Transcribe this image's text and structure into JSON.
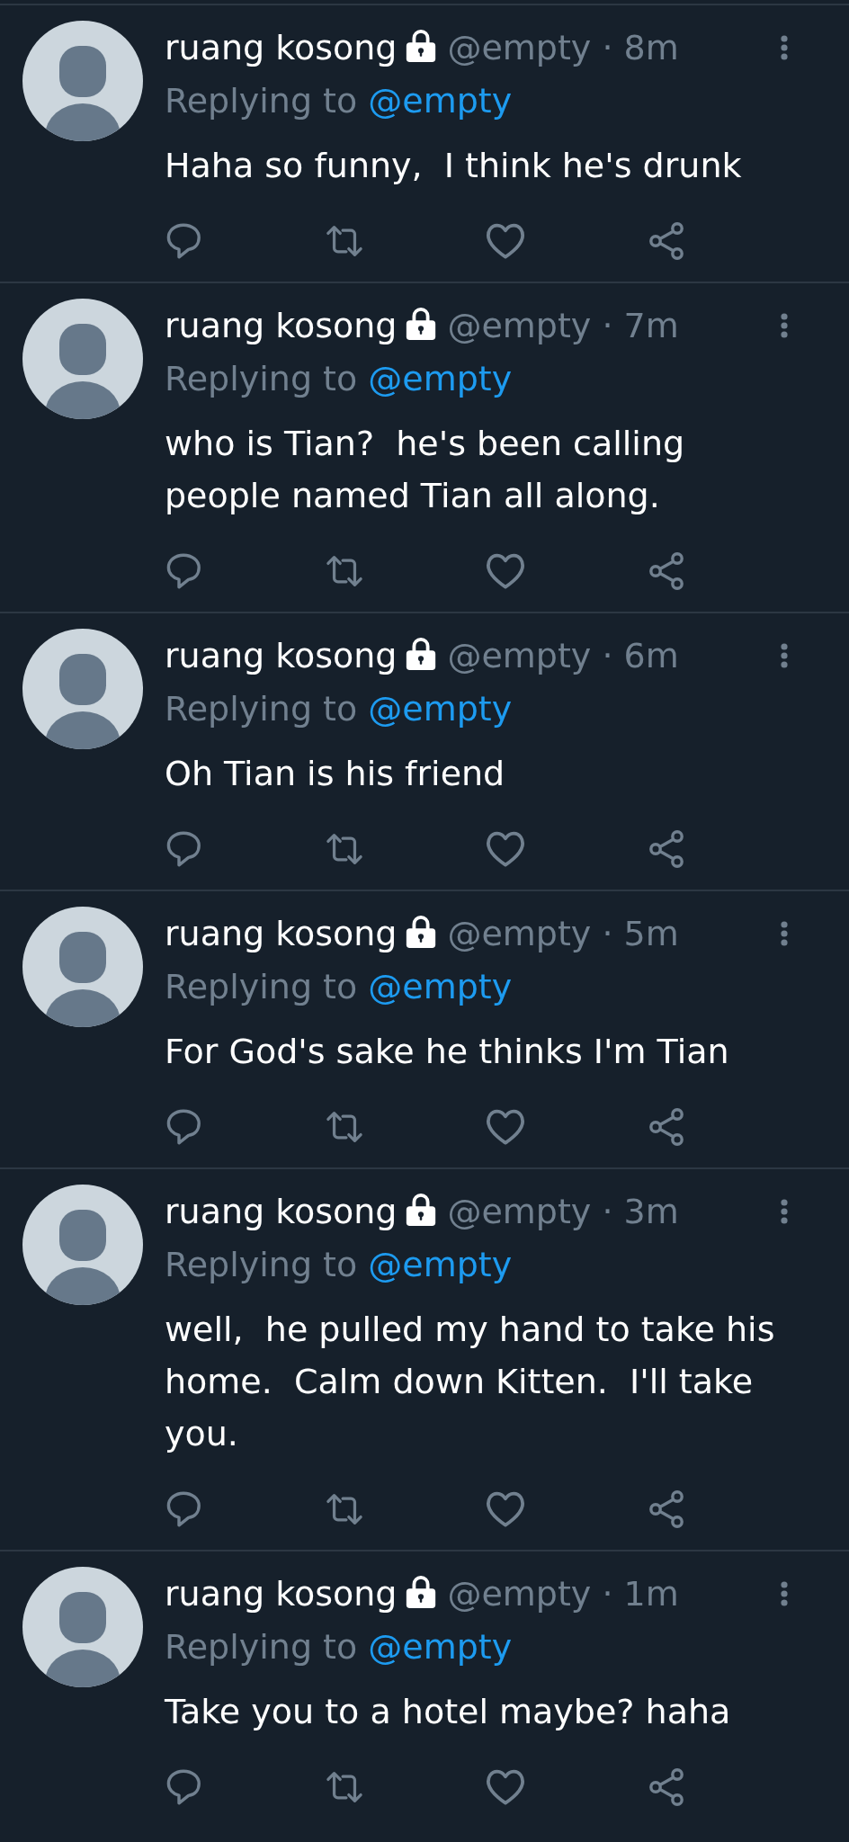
{
  "tweets": [
    {
      "name": "ruang kosong",
      "protected": true,
      "meta": "@empty · 8m",
      "reply_label": "Replying to",
      "reply_to": "@empty",
      "text": "Haha so funny,  I think he's drunk"
    },
    {
      "name": "ruang kosong",
      "protected": true,
      "meta": "@empty · 7m",
      "reply_label": "Replying to",
      "reply_to": "@empty",
      "text": "who is Tian?  he's been calling people named Tian all along."
    },
    {
      "name": "ruang kosong",
      "protected": true,
      "meta": "@empty · 6m",
      "reply_label": "Replying to",
      "reply_to": "@empty",
      "text": "Oh Tian is his friend"
    },
    {
      "name": "ruang kosong",
      "protected": true,
      "meta": "@empty · 5m",
      "reply_label": "Replying to",
      "reply_to": "@empty",
      "text": "For God's sake he thinks I'm Tian"
    },
    {
      "name": "ruang kosong",
      "protected": true,
      "meta": "@empty · 3m",
      "reply_label": "Replying to",
      "reply_to": "@empty",
      "text": "well,  he pulled my hand to take his home.  Calm down Kitten.  I'll take you."
    },
    {
      "name": "ruang kosong",
      "protected": true,
      "meta": "@empty · 1m",
      "reply_label": "Replying to",
      "reply_to": "@empty",
      "text": "Take you to a hotel maybe? haha"
    }
  ]
}
